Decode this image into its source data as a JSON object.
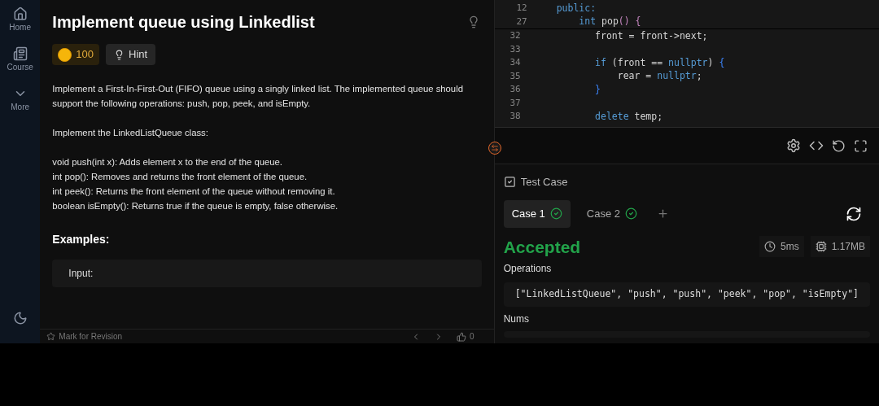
{
  "sidebar": {
    "items": [
      {
        "label": "Home"
      },
      {
        "label": "Course"
      },
      {
        "label": "More"
      }
    ]
  },
  "problem": {
    "title": "Implement queue using Linkedlist",
    "coins": "100",
    "hint": "Hint",
    "paragraphs": [
      [
        "Implement a First-In-First-Out (FIFO) queue using a singly linked list. The implemented queue should support the following operations: push, pop, peek, and isEmpty."
      ],
      [
        "Implement the LinkedListQueue class:"
      ],
      [
        "void push(int x): Adds element x to the end of the queue.",
        "int pop(): Removes and returns the front element of the queue.",
        "int peek(): Returns the front element of the queue without removing it.",
        "boolean isEmpty(): Returns true if the queue is empty, false otherwise."
      ]
    ],
    "examples_heading": "Examples:",
    "example_input": "Input:"
  },
  "bottom_bar": {
    "mark": "Mark for Revision",
    "likes": "0"
  },
  "editor": {
    "sticky": [
      {
        "num": "12",
        "tokens": [
          {
            "kind": "kw",
            "text": "public:"
          }
        ]
      },
      {
        "num": "27",
        "tokens": [
          {
            "kind": "kw",
            "text": "    int"
          },
          {
            "kind": "plain",
            "text": " pop"
          },
          {
            "kind": "punct",
            "text": "() {"
          }
        ]
      }
    ],
    "lines": [
      {
        "num": "32",
        "tokens": [
          {
            "kind": "plain",
            "text": "        front = front->next;"
          }
        ]
      },
      {
        "num": "33"
      },
      {
        "num": "34",
        "tokens": [
          {
            "kind": "kw",
            "text": "        if"
          },
          {
            "kind": "plain",
            "text": " (front == "
          },
          {
            "kind": "kw",
            "text": "nullptr"
          },
          {
            "kind": "plain",
            "text": ") "
          },
          {
            "kind": "brace",
            "text": "{"
          }
        ]
      },
      {
        "num": "35",
        "tokens": [
          {
            "kind": "plain",
            "text": "            rear = "
          },
          {
            "kind": "kw",
            "text": "nullptr"
          },
          {
            "kind": "plain",
            "text": ";"
          }
        ]
      },
      {
        "num": "36",
        "tokens": [
          {
            "kind": "brace",
            "text": "        }"
          }
        ]
      },
      {
        "num": "37"
      },
      {
        "num": "38",
        "tokens": [
          {
            "kind": "kw",
            "text": "        delete"
          },
          {
            "kind": "plain",
            "text": " temp;"
          }
        ]
      }
    ]
  },
  "test_panel": {
    "title": "Test Case",
    "cases": [
      {
        "label": "Case 1",
        "selected": true,
        "passed": true
      },
      {
        "label": "Case 2",
        "selected": false,
        "passed": true
      }
    ],
    "status": "Accepted",
    "time": "5ms",
    "memory": "1.17MB",
    "operations_label": "Operations",
    "operations": "[\"LinkedListQueue\", \"push\", \"push\", \"peek\", \"pop\", \"isEmpty\"]",
    "nums_label": "Nums"
  }
}
